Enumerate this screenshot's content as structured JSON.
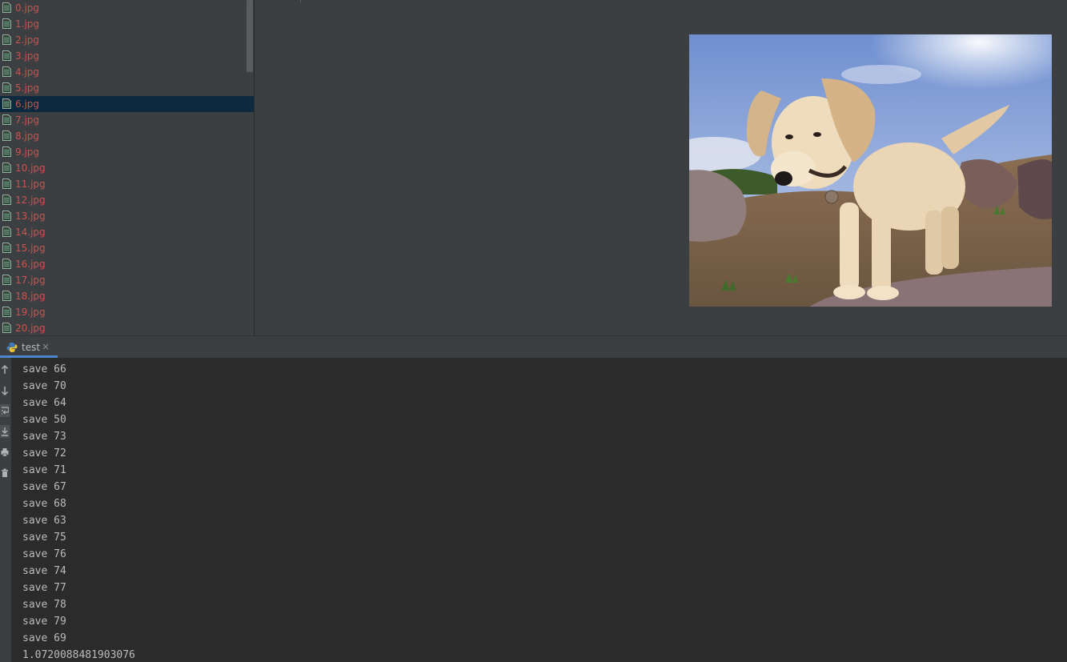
{
  "project_tree": {
    "files": [
      "0.jpg",
      "1.jpg",
      "2.jpg",
      "3.jpg",
      "4.jpg",
      "5.jpg",
      "6.jpg",
      "7.jpg",
      "8.jpg",
      "9.jpg",
      "10.jpg",
      "11.jpg",
      "12.jpg",
      "13.jpg",
      "14.jpg",
      "15.jpg",
      "16.jpg",
      "17.jpg",
      "18.jpg",
      "19.jpg",
      "20.jpg"
    ],
    "selected": "6.jpg",
    "file_icon": "image-file-icon"
  },
  "viewer": {
    "image": "puppy-photo"
  },
  "run_panel": {
    "tab_label": "test",
    "tab_icon": "python-icon",
    "close_glyph": "×",
    "toolbar": [
      "up-arrow-icon",
      "down-arrow-icon",
      "soft-wrap-icon",
      "scroll-to-end-icon",
      "print-icon",
      "trash-icon"
    ],
    "output": [
      "save 66",
      "save 70",
      "save 64",
      "save 50",
      "save 73",
      "save 72",
      "save 71",
      "save 67",
      "save 68",
      "save 63",
      "save 75",
      "save 76",
      "save 74",
      "save 77",
      "save 78",
      "save 79",
      "save 69",
      "1.0720088481903076"
    ]
  },
  "colors": {
    "file_text": "#c75450",
    "selection": "#0d293e",
    "console_text": "#bbbbbb",
    "panel_bg": "#3c3f41",
    "console_bg": "#2b2b2b",
    "accent": "#4a88c7"
  }
}
